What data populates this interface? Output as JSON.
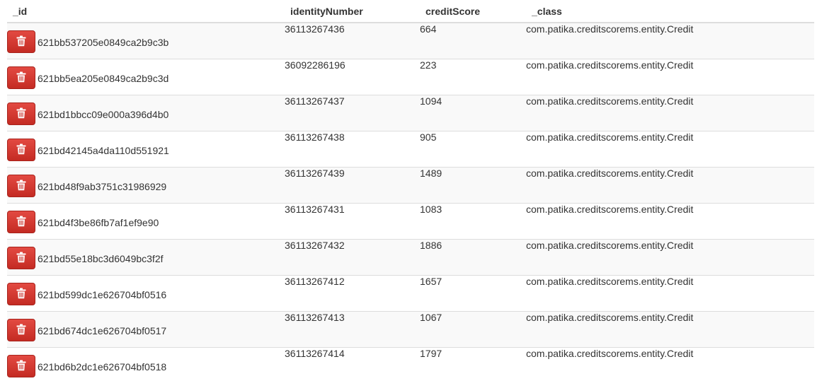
{
  "table": {
    "headers": {
      "id": "_id",
      "identityNumber": "identityNumber",
      "creditScore": "creditScore",
      "class": "_class"
    },
    "delete_icon": "trash-icon",
    "colors": {
      "delete_button": "#d9342b",
      "row_stripe": "#f9f9f9",
      "border": "#dddddd"
    },
    "rows": [
      {
        "id": "621bb537205e0849ca2b9c3b",
        "identityNumber": "36113267436",
        "creditScore": "664",
        "class": "com.patika.creditscorems.entity.Credit"
      },
      {
        "id": "621bb5ea205e0849ca2b9c3d",
        "identityNumber": "36092286196",
        "creditScore": "223",
        "class": "com.patika.creditscorems.entity.Credit"
      },
      {
        "id": "621bd1bbcc09e000a396d4b0",
        "identityNumber": "36113267437",
        "creditScore": "1094",
        "class": "com.patika.creditscorems.entity.Credit"
      },
      {
        "id": "621bd42145a4da110d551921",
        "identityNumber": "36113267438",
        "creditScore": "905",
        "class": "com.patika.creditscorems.entity.Credit"
      },
      {
        "id": "621bd48f9ab3751c31986929",
        "identityNumber": "36113267439",
        "creditScore": "1489",
        "class": "com.patika.creditscorems.entity.Credit"
      },
      {
        "id": "621bd4f3be86fb7af1ef9e90",
        "identityNumber": "36113267431",
        "creditScore": "1083",
        "class": "com.patika.creditscorems.entity.Credit"
      },
      {
        "id": "621bd55e18bc3d6049bc3f2f",
        "identityNumber": "36113267432",
        "creditScore": "1886",
        "class": "com.patika.creditscorems.entity.Credit"
      },
      {
        "id": "621bd599dc1e626704bf0516",
        "identityNumber": "36113267412",
        "creditScore": "1657",
        "class": "com.patika.creditscorems.entity.Credit"
      },
      {
        "id": "621bd674dc1e626704bf0517",
        "identityNumber": "36113267413",
        "creditScore": "1067",
        "class": "com.patika.creditscorems.entity.Credit"
      },
      {
        "id": "621bd6b2dc1e626704bf0518",
        "identityNumber": "36113267414",
        "creditScore": "1797",
        "class": "com.patika.creditscorems.entity.Credit"
      }
    ]
  }
}
